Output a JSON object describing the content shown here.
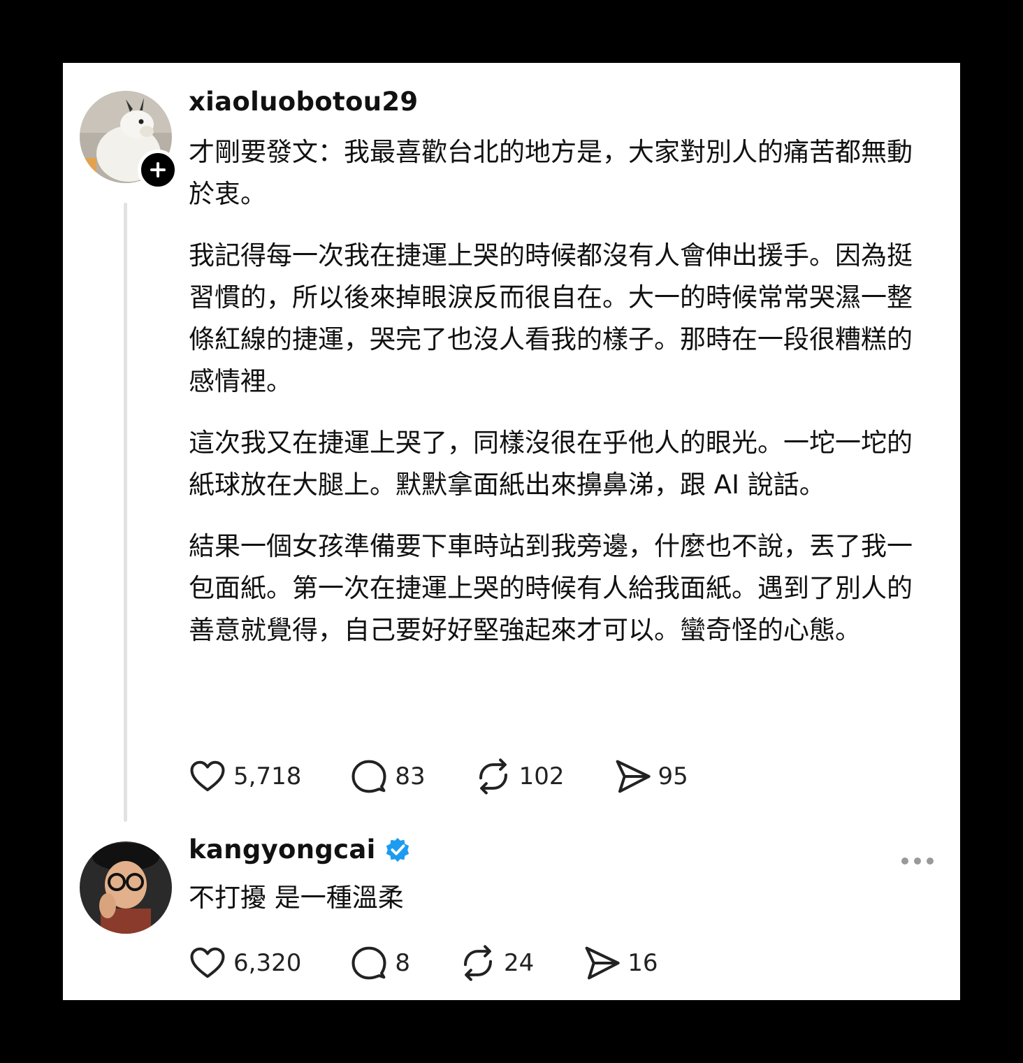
{
  "posts": [
    {
      "username": "xiaoluobotou29",
      "verified": false,
      "avatar_icon": "avatar-felt-goat",
      "paragraphs": [
        "才剛要發文：我最喜歡台北的地方是，大家對別人的痛苦都無動於衷。",
        "我記得每一次我在捷運上哭的時候都沒有人會伸出援手。因為挺習慣的，所以後來掉眼淚反而很自在。大一的時候常常哭濕一整條紅線的捷運，哭完了也沒人看我的樣子。那時在一段很糟糕的感情裡。",
        "這次我又在捷運上哭了，同樣沒很在乎他人的眼光。一坨一坨的紙球放在大腿上。默默拿面紙出來擤鼻涕，跟 AI 說話。",
        "結果一個女孩準備要下車時站到我旁邊，什麼也不說，丟了我一包面紙。第一次在捷運上哭的時候有人給我面紙。遇到了別人的善意就覺得，自己要好好堅強起來才可以。蠻奇怪的心態。"
      ],
      "likes": "5,718",
      "replies": "83",
      "reposts": "102",
      "shares": "95"
    },
    {
      "username": "kangyongcai",
      "verified": true,
      "avatar_icon": "avatar-man-glasses-beret",
      "paragraphs": [
        "不打擾 是一種溫柔"
      ],
      "likes": "6,320",
      "replies": "8",
      "reposts": "24",
      "shares": "16"
    }
  ],
  "colors": {
    "verified": "#1d9bf0",
    "text": "#111111",
    "thread_line": "#e2e2e2"
  }
}
